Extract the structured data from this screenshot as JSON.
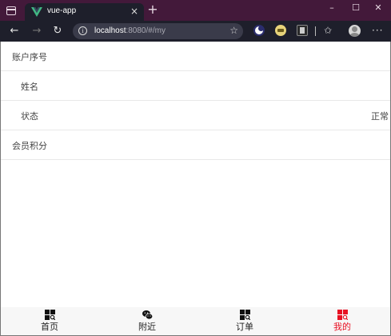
{
  "browser": {
    "tab_title": "vue-app",
    "tab_close": "×",
    "new_tab": "+",
    "url_host": "localhost",
    "url_rest": ":8080/#/my",
    "window_minimize": "–",
    "window_maximize": "☐",
    "window_close": "✕",
    "back": "←",
    "forward": "→",
    "reload": "↻",
    "more": "···"
  },
  "account": {
    "rows": [
      {
        "label": "账户序号",
        "value": ""
      },
      {
        "label": "姓名",
        "value": ""
      },
      {
        "label": "状态",
        "value": "正常"
      },
      {
        "label": "会员积分",
        "value": ""
      }
    ]
  },
  "bottom_nav": {
    "items": [
      {
        "label": "首页",
        "icon": "qr-grid-icon"
      },
      {
        "label": "附近",
        "icon": "wechat-icon"
      },
      {
        "label": "订单",
        "icon": "qr-grid-icon"
      },
      {
        "label": "我的",
        "icon": "qr-grid-icon"
      }
    ],
    "active_index": 3
  },
  "colors": {
    "titlebar": "#43193a",
    "toolbar": "#1e1f2b",
    "active_nav": "#e81123"
  }
}
